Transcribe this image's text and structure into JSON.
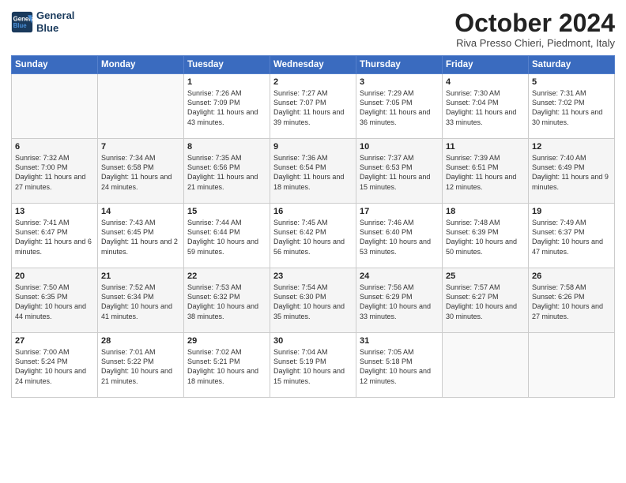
{
  "header": {
    "logo_line1": "General",
    "logo_line2": "Blue",
    "month_title": "October 2024",
    "subtitle": "Riva Presso Chieri, Piedmont, Italy"
  },
  "weekdays": [
    "Sunday",
    "Monday",
    "Tuesday",
    "Wednesday",
    "Thursday",
    "Friday",
    "Saturday"
  ],
  "weeks": [
    [
      {
        "day": "",
        "info": ""
      },
      {
        "day": "",
        "info": ""
      },
      {
        "day": "1",
        "info": "Sunrise: 7:26 AM\nSunset: 7:09 PM\nDaylight: 11 hours and 43 minutes."
      },
      {
        "day": "2",
        "info": "Sunrise: 7:27 AM\nSunset: 7:07 PM\nDaylight: 11 hours and 39 minutes."
      },
      {
        "day": "3",
        "info": "Sunrise: 7:29 AM\nSunset: 7:05 PM\nDaylight: 11 hours and 36 minutes."
      },
      {
        "day": "4",
        "info": "Sunrise: 7:30 AM\nSunset: 7:04 PM\nDaylight: 11 hours and 33 minutes."
      },
      {
        "day": "5",
        "info": "Sunrise: 7:31 AM\nSunset: 7:02 PM\nDaylight: 11 hours and 30 minutes."
      }
    ],
    [
      {
        "day": "6",
        "info": "Sunrise: 7:32 AM\nSunset: 7:00 PM\nDaylight: 11 hours and 27 minutes."
      },
      {
        "day": "7",
        "info": "Sunrise: 7:34 AM\nSunset: 6:58 PM\nDaylight: 11 hours and 24 minutes."
      },
      {
        "day": "8",
        "info": "Sunrise: 7:35 AM\nSunset: 6:56 PM\nDaylight: 11 hours and 21 minutes."
      },
      {
        "day": "9",
        "info": "Sunrise: 7:36 AM\nSunset: 6:54 PM\nDaylight: 11 hours and 18 minutes."
      },
      {
        "day": "10",
        "info": "Sunrise: 7:37 AM\nSunset: 6:53 PM\nDaylight: 11 hours and 15 minutes."
      },
      {
        "day": "11",
        "info": "Sunrise: 7:39 AM\nSunset: 6:51 PM\nDaylight: 11 hours and 12 minutes."
      },
      {
        "day": "12",
        "info": "Sunrise: 7:40 AM\nSunset: 6:49 PM\nDaylight: 11 hours and 9 minutes."
      }
    ],
    [
      {
        "day": "13",
        "info": "Sunrise: 7:41 AM\nSunset: 6:47 PM\nDaylight: 11 hours and 6 minutes."
      },
      {
        "day": "14",
        "info": "Sunrise: 7:43 AM\nSunset: 6:45 PM\nDaylight: 11 hours and 2 minutes."
      },
      {
        "day": "15",
        "info": "Sunrise: 7:44 AM\nSunset: 6:44 PM\nDaylight: 10 hours and 59 minutes."
      },
      {
        "day": "16",
        "info": "Sunrise: 7:45 AM\nSunset: 6:42 PM\nDaylight: 10 hours and 56 minutes."
      },
      {
        "day": "17",
        "info": "Sunrise: 7:46 AM\nSunset: 6:40 PM\nDaylight: 10 hours and 53 minutes."
      },
      {
        "day": "18",
        "info": "Sunrise: 7:48 AM\nSunset: 6:39 PM\nDaylight: 10 hours and 50 minutes."
      },
      {
        "day": "19",
        "info": "Sunrise: 7:49 AM\nSunset: 6:37 PM\nDaylight: 10 hours and 47 minutes."
      }
    ],
    [
      {
        "day": "20",
        "info": "Sunrise: 7:50 AM\nSunset: 6:35 PM\nDaylight: 10 hours and 44 minutes."
      },
      {
        "day": "21",
        "info": "Sunrise: 7:52 AM\nSunset: 6:34 PM\nDaylight: 10 hours and 41 minutes."
      },
      {
        "day": "22",
        "info": "Sunrise: 7:53 AM\nSunset: 6:32 PM\nDaylight: 10 hours and 38 minutes."
      },
      {
        "day": "23",
        "info": "Sunrise: 7:54 AM\nSunset: 6:30 PM\nDaylight: 10 hours and 35 minutes."
      },
      {
        "day": "24",
        "info": "Sunrise: 7:56 AM\nSunset: 6:29 PM\nDaylight: 10 hours and 33 minutes."
      },
      {
        "day": "25",
        "info": "Sunrise: 7:57 AM\nSunset: 6:27 PM\nDaylight: 10 hours and 30 minutes."
      },
      {
        "day": "26",
        "info": "Sunrise: 7:58 AM\nSunset: 6:26 PM\nDaylight: 10 hours and 27 minutes."
      }
    ],
    [
      {
        "day": "27",
        "info": "Sunrise: 7:00 AM\nSunset: 5:24 PM\nDaylight: 10 hours and 24 minutes."
      },
      {
        "day": "28",
        "info": "Sunrise: 7:01 AM\nSunset: 5:22 PM\nDaylight: 10 hours and 21 minutes."
      },
      {
        "day": "29",
        "info": "Sunrise: 7:02 AM\nSunset: 5:21 PM\nDaylight: 10 hours and 18 minutes."
      },
      {
        "day": "30",
        "info": "Sunrise: 7:04 AM\nSunset: 5:19 PM\nDaylight: 10 hours and 15 minutes."
      },
      {
        "day": "31",
        "info": "Sunrise: 7:05 AM\nSunset: 5:18 PM\nDaylight: 10 hours and 12 minutes."
      },
      {
        "day": "",
        "info": ""
      },
      {
        "day": "",
        "info": ""
      }
    ]
  ]
}
